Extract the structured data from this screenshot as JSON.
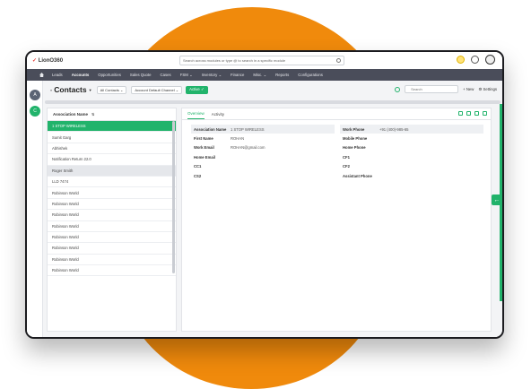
{
  "colors": {
    "accent": "#21b36b",
    "brand_orange": "#f08a0c",
    "navbar": "#4a4d5a"
  },
  "app": {
    "logo": "LionO360",
    "global_search_placeholder": "Search across modules or type @ to search in a specific module"
  },
  "navbar": {
    "items": [
      "Leads",
      "Accounts",
      "Opportunities",
      "Sales Quote",
      "Cases",
      "FSM ⌄",
      "Inventory ⌄",
      "Finance",
      "Misc. ⌄",
      "Reports",
      "Configurations"
    ]
  },
  "rail": {
    "items": [
      "A",
      "C"
    ]
  },
  "toolbar": {
    "title": "Contacts",
    "filter": "All Contacts",
    "channel": "Account Default Channel",
    "active_label": "Active ✓",
    "search_placeholder": "Search",
    "new_label": "+ New",
    "settings_label": "Settings"
  },
  "list": {
    "header": "Association Name",
    "sort_icon": "sort-icon",
    "rows": [
      "1 STOP WIRELESS",
      "Sumit Garg",
      "Abhishek",
      "Notification Return 22.0",
      "Roger Smith",
      "LLD 7474",
      "Robinson World",
      "Robinson World",
      "Robinson World",
      "Robinson World",
      "Robinson World",
      "Robinson World",
      "Robinson World",
      "Robinson World"
    ]
  },
  "detail": {
    "tabs": [
      "Overview",
      "Activity"
    ],
    "rows": [
      {
        "l_label": "Association Name",
        "l_val": "1 STOP WIRELESS",
        "r_label": "Work Phone",
        "r_val": "+91 (400)-985-65",
        "shade": true
      },
      {
        "l_label": "First Name",
        "l_val": "ROHAN",
        "r_label": "Mobile Phone",
        "r_val": "",
        "shade": false
      },
      {
        "l_label": "Work Email",
        "l_val": "ROHAN@gmail.com",
        "r_label": "Home Phone",
        "r_val": "",
        "shade": false
      },
      {
        "l_label": "Home Email",
        "l_val": "",
        "r_label": "CF1",
        "r_val": "",
        "shade": false
      },
      {
        "l_label": "CC1",
        "l_val": "",
        "r_label": "CF2",
        "r_val": "",
        "shade": false
      },
      {
        "l_label": "CS2",
        "l_val": "",
        "r_label": "Assistant Phone",
        "r_val": "",
        "shade": false
      }
    ]
  }
}
